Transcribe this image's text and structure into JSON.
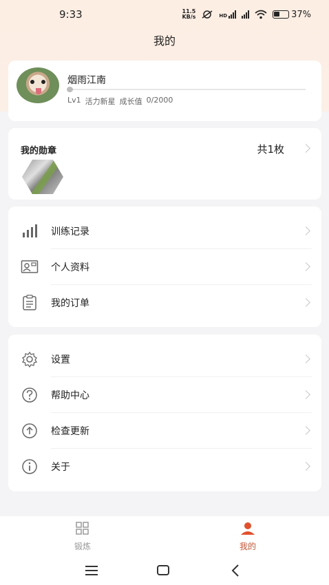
{
  "status_bar": {
    "time": "9:33",
    "speed_value": "11.5",
    "speed_unit": "KB/s",
    "hd_label": "HD",
    "battery": "37%"
  },
  "header": {
    "title": "我的"
  },
  "profile": {
    "username": "烟雨江南",
    "level": "Lv1",
    "level_name": "活力新星",
    "growth_label": "成长值",
    "growth_value": "0/2000",
    "growth_progress": 0
  },
  "medals": {
    "title": "我的勋章",
    "count_text": "共1枚",
    "items": [
      "medal"
    ]
  },
  "menu_group_1": [
    {
      "label": "训练记录",
      "icon": "bar-chart-icon"
    },
    {
      "label": "个人资料",
      "icon": "id-card-icon"
    },
    {
      "label": "我的订单",
      "icon": "clipboard-icon"
    }
  ],
  "menu_group_2": [
    {
      "label": "设置",
      "icon": "gear-icon"
    },
    {
      "label": "帮助中心",
      "icon": "question-icon"
    },
    {
      "label": "检查更新",
      "icon": "upload-icon"
    },
    {
      "label": "关于",
      "icon": "info-icon"
    }
  ],
  "tabbar": {
    "tabs": [
      {
        "label": "锻炼",
        "icon": "grid-icon",
        "active": false
      },
      {
        "label": "我的",
        "icon": "person-icon",
        "active": true
      }
    ],
    "active_color": "#e5502a",
    "inactive_color": "#9a9a9a"
  },
  "colors": {
    "accent": "#e5502a",
    "header_bg": "#fdeee4",
    "page_bg": "#f4f4f6"
  }
}
